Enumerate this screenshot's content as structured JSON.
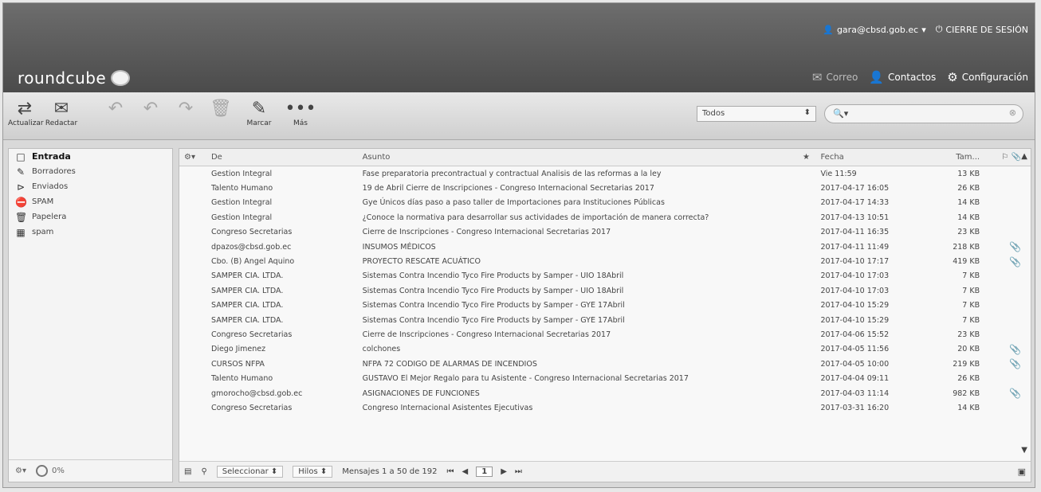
{
  "header": {
    "user": "gara@cbsd.gob.ec",
    "logout": "CIERRE DE SESIÓN",
    "logo": "roundcube",
    "nav": [
      {
        "label": "Correo",
        "icon": "envelope-icon"
      },
      {
        "label": "Contactos",
        "icon": "person-icon"
      },
      {
        "label": "Configuración",
        "icon": "gear-icon"
      }
    ]
  },
  "toolbar": {
    "actualizar": "Actualizar",
    "redactar": "Redactar",
    "marcar": "Marcar",
    "mas": "Más",
    "filter": "Todos",
    "search_placeholder": ""
  },
  "folders": [
    {
      "label": "Entrada",
      "icon": "inbox-icon"
    },
    {
      "label": "Borradores",
      "icon": "pencil-icon"
    },
    {
      "label": "Enviados",
      "icon": "sent-icon"
    },
    {
      "label": "SPAM",
      "icon": "spam-icon"
    },
    {
      "label": "Papelera",
      "icon": "trash-icon"
    },
    {
      "label": "spam",
      "icon": "folder-icon"
    }
  ],
  "quota": "0%",
  "columns": {
    "from": "De",
    "subject": "Asunto",
    "date": "Fecha",
    "size": "Tam..."
  },
  "messages": [
    {
      "from": "Gestion Integral",
      "subject": "Fase preparatoria precontractual y contractual Analisis de las reformas a la ley",
      "date": "Vie 11:59",
      "size": "13 KB",
      "att": ""
    },
    {
      "from": "Talento Humano",
      "subject": "19 de Abril Cierre de Inscripciones - Congreso Internacional Secretarias 2017",
      "date": "2017-04-17 16:05",
      "size": "26 KB",
      "att": ""
    },
    {
      "from": "Gestion Integral",
      "subject": "Gye Únicos días paso a paso taller de Importaciones para Instituciones Públicas",
      "date": "2017-04-17 14:33",
      "size": "14 KB",
      "att": ""
    },
    {
      "from": "Gestion Integral",
      "subject": "¿Conoce la normativa para desarrollar sus actividades de importación de manera correcta?",
      "date": "2017-04-13 10:51",
      "size": "14 KB",
      "att": ""
    },
    {
      "from": "Congreso Secretarias",
      "subject": "Cierre de Inscripciones - Congreso Internacional Secretarias 2017",
      "date": "2017-04-11 16:35",
      "size": "23 KB",
      "att": ""
    },
    {
      "from": "dpazos@cbsd.gob.ec",
      "subject": "INSUMOS MÉDICOS",
      "date": "2017-04-11 11:49",
      "size": "218 KB",
      "att": "📎"
    },
    {
      "from": "Cbo. (B) Angel Aquino",
      "subject": "PROYECTO RESCATE ACUÁTICO",
      "date": "2017-04-10 17:17",
      "size": "419 KB",
      "att": "📎"
    },
    {
      "from": "SAMPER CIA. LTDA.",
      "subject": "Sistemas Contra Incendio Tyco Fire Products by Samper - UIO 18Abril",
      "date": "2017-04-10 17:03",
      "size": "7 KB",
      "att": ""
    },
    {
      "from": "SAMPER CIA. LTDA.",
      "subject": "Sistemas Contra Incendio Tyco Fire Products by Samper - UIO 18Abril",
      "date": "2017-04-10 17:03",
      "size": "7 KB",
      "att": ""
    },
    {
      "from": "SAMPER CIA. LTDA.",
      "subject": "Sistemas Contra Incendio Tyco Fire Products by Samper - GYE 17Abril",
      "date": "2017-04-10 15:29",
      "size": "7 KB",
      "att": ""
    },
    {
      "from": "SAMPER CIA. LTDA.",
      "subject": "Sistemas Contra Incendio Tyco Fire Products by Samper - GYE 17Abril",
      "date": "2017-04-10 15:29",
      "size": "7 KB",
      "att": ""
    },
    {
      "from": "Congreso Secretarias",
      "subject": "Cierre de Inscripciones - Congreso Internacional Secretarias 2017",
      "date": "2017-04-06 15:52",
      "size": "23 KB",
      "att": ""
    },
    {
      "from": "Diego Jimenez",
      "subject": "colchones",
      "date": "2017-04-05 11:56",
      "size": "20 KB",
      "att": "📎"
    },
    {
      "from": "CURSOS NFPA",
      "subject": "NFPA 72 CODIGO DE ALARMAS DE INCENDIOS",
      "date": "2017-04-05 10:00",
      "size": "219 KB",
      "att": "📎"
    },
    {
      "from": "Talento Humano",
      "subject": "GUSTAVO El Mejor Regalo para tu Asistente - Congreso Internacional Secretarias 2017",
      "date": "2017-04-04 09:11",
      "size": "26 KB",
      "att": ""
    },
    {
      "from": "gmorocho@cbsd.gob.ec",
      "subject": "ASIGNACIONES DE FUNCIONES",
      "date": "2017-04-03 11:14",
      "size": "982 KB",
      "att": "📎"
    },
    {
      "from": "Congreso Secretarias",
      "subject": "Congreso Internacional Asistentes Ejecutivas",
      "date": "2017-03-31 16:20",
      "size": "14 KB",
      "att": ""
    }
  ],
  "footer": {
    "select": "Seleccionar",
    "threads": "Hilos",
    "count": "Mensajes 1 a 50 de 192",
    "page": "1"
  }
}
